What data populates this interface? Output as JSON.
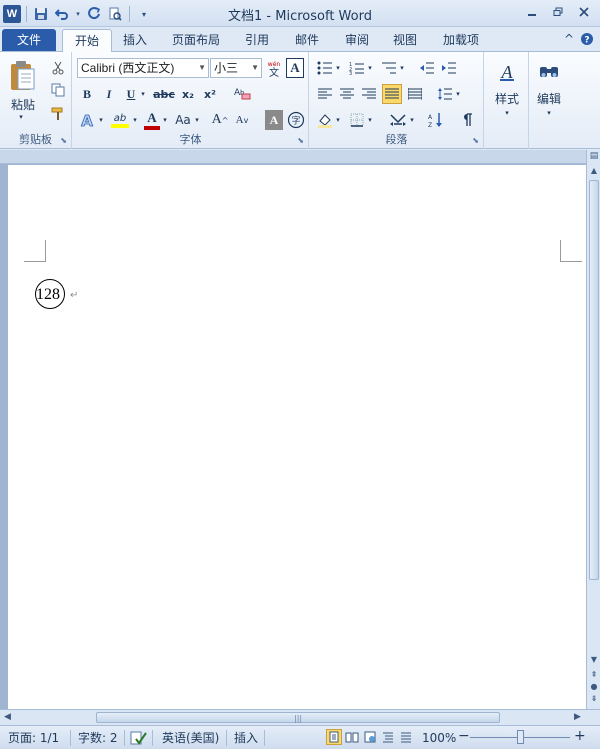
{
  "window": {
    "title": "文档1 - Microsoft Word",
    "minimize_icon": "minimize-icon",
    "restore_icon": "restore-icon",
    "close_icon": "close-icon"
  },
  "quick_access": {
    "logo_letter": "W",
    "icons": [
      "save-icon",
      "undo-icon",
      "redo-icon",
      "print-preview-icon",
      "customize-icon"
    ]
  },
  "tabs": [
    {
      "label": "文件"
    },
    {
      "label": "开始"
    },
    {
      "label": "插入"
    },
    {
      "label": "页面布局"
    },
    {
      "label": "引用"
    },
    {
      "label": "邮件"
    },
    {
      "label": "审阅"
    },
    {
      "label": "视图"
    },
    {
      "label": "加载项"
    }
  ],
  "ribbon": {
    "clipboard": {
      "label": "剪贴板",
      "paste_label": "粘贴"
    },
    "font": {
      "label": "字体",
      "font_name": "Calibri (西文正文)",
      "font_size": "小三",
      "bold": "B",
      "italic": "I",
      "underline": "U",
      "strike": "abc",
      "subscript": "x₂",
      "superscript": "x²",
      "grow": "A",
      "shrink": "A",
      "change_case": "Aa",
      "phonetic": "wén",
      "border_char": "A",
      "enclose_char": "字",
      "highlight": "ab",
      "font_color": "A"
    },
    "paragraph": {
      "label": "段落"
    },
    "styles": {
      "label": "样式"
    },
    "editing": {
      "label": "编辑"
    }
  },
  "document": {
    "text": "128",
    "enclosed_char": true
  },
  "status": {
    "page": "页面: 1/1",
    "words": "字数: 2",
    "language": "英语(美国)",
    "mode": "插入",
    "zoom": "100%",
    "zoom_minus": "−",
    "zoom_plus": "+"
  },
  "colors": {
    "file_tab": "#2a5caa",
    "highlight": "#ffff00",
    "font_color": "#c00000",
    "selected": "#fbd86a"
  }
}
